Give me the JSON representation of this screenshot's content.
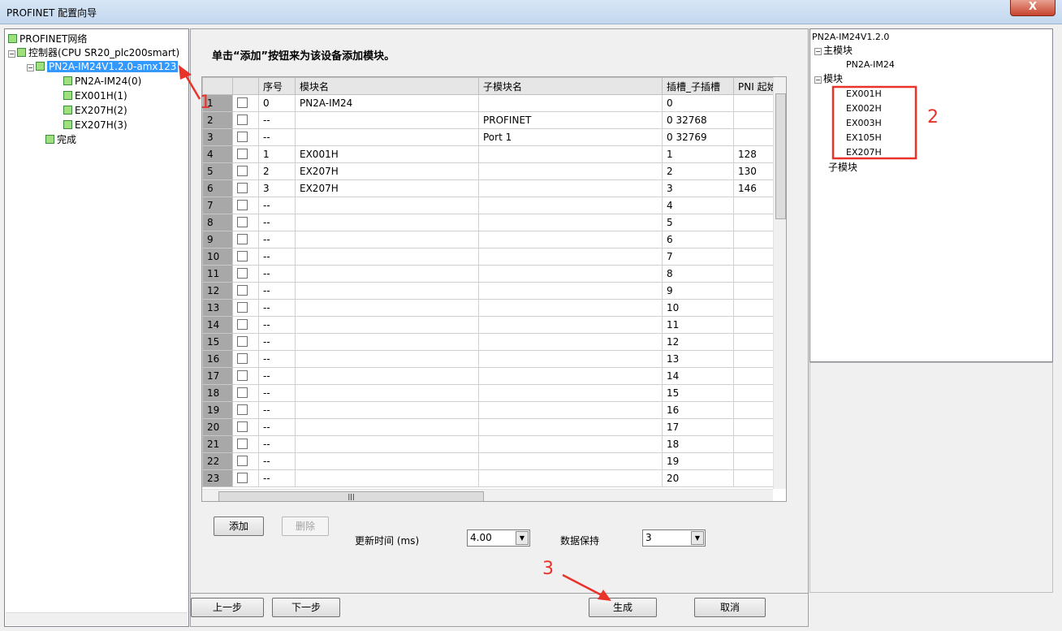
{
  "window": {
    "title": "PROFINET 配置向导",
    "close": "X"
  },
  "tree": {
    "root": "PROFINET网络",
    "controller": "控制器(CPU SR20_plc200smart)",
    "device": "PN2A-IM24V1.2.0-amx123",
    "modules": [
      "PN2A-IM24(0)",
      "EX001H(1)",
      "EX207H(2)",
      "EX207H(3)"
    ],
    "finish": "完成"
  },
  "instruction": "单击“添加”按钮来为该设备添加模块。",
  "table": {
    "headers": [
      "",
      "",
      "序号",
      "模块名",
      "子模块名",
      "插槽_子插槽",
      "PNI 起始"
    ],
    "rows": [
      [
        "1",
        "0",
        "PN2A-IM24",
        "",
        "0",
        ""
      ],
      [
        "2",
        "--",
        "",
        "PROFINET",
        "0 32768",
        ""
      ],
      [
        "3",
        "--",
        "",
        "Port 1",
        "0 32769",
        ""
      ],
      [
        "4",
        "1",
        "EX001H",
        "",
        "1",
        "128"
      ],
      [
        "5",
        "2",
        "EX207H",
        "",
        "2",
        "130"
      ],
      [
        "6",
        "3",
        "EX207H",
        "",
        "3",
        "146"
      ],
      [
        "7",
        "--",
        "",
        "",
        "4",
        ""
      ],
      [
        "8",
        "--",
        "",
        "",
        "5",
        ""
      ],
      [
        "9",
        "--",
        "",
        "",
        "6",
        ""
      ],
      [
        "10",
        "--",
        "",
        "",
        "7",
        ""
      ],
      [
        "11",
        "--",
        "",
        "",
        "8",
        ""
      ],
      [
        "12",
        "--",
        "",
        "",
        "9",
        ""
      ],
      [
        "13",
        "--",
        "",
        "",
        "10",
        ""
      ],
      [
        "14",
        "--",
        "",
        "",
        "11",
        ""
      ],
      [
        "15",
        "--",
        "",
        "",
        "12",
        ""
      ],
      [
        "16",
        "--",
        "",
        "",
        "13",
        ""
      ],
      [
        "17",
        "--",
        "",
        "",
        "14",
        ""
      ],
      [
        "18",
        "--",
        "",
        "",
        "15",
        ""
      ],
      [
        "19",
        "--",
        "",
        "",
        "16",
        ""
      ],
      [
        "20",
        "--",
        "",
        "",
        "17",
        ""
      ],
      [
        "21",
        "--",
        "",
        "",
        "18",
        ""
      ],
      [
        "22",
        "--",
        "",
        "",
        "19",
        ""
      ],
      [
        "23",
        "--",
        "",
        "",
        "20",
        ""
      ]
    ]
  },
  "buttons": {
    "add": "添加",
    "delete": "删除",
    "prev": "上一步",
    "next": "下一步",
    "generate": "生成",
    "cancel": "取消"
  },
  "update_time": {
    "label": "更新时间 (ms)",
    "value": "4.00"
  },
  "data_hold": {
    "label": "数据保持",
    "value": "3"
  },
  "catalog": {
    "title": "PN2A-IM24V1.2.0",
    "main_module": "主模块",
    "main_items": [
      "PN2A-IM24"
    ],
    "module": "模块",
    "module_items": [
      "EX001H",
      "EX002H",
      "EX003H",
      "EX105H",
      "EX207H"
    ],
    "submodule": "子模块"
  },
  "annotations": {
    "a1": "1",
    "a2": "2",
    "a3": "3"
  },
  "colors": {
    "selection": "#3399ff",
    "annotation": "#e8322a",
    "node_icon": "#9fe07d"
  }
}
